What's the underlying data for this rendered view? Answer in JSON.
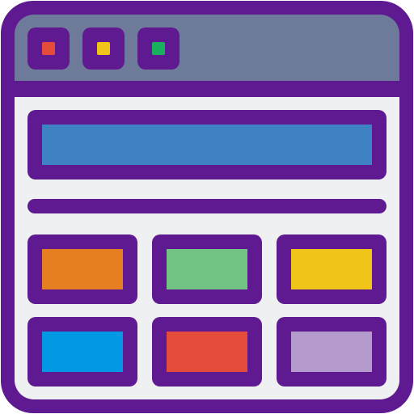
{
  "icon_name": "browser-window-layout-icon",
  "colors": {
    "outline": "#5F1A92",
    "titlebar": "#6E7A99",
    "content_bg": "#EEF0F2",
    "button_close": "#E64C3C",
    "button_minimize": "#F1C419",
    "button_maximize": "#1AAF5D",
    "banner": "#3F82C3",
    "tile_1": "#E67F22",
    "tile_2": "#72C485",
    "tile_3": "#F1C419",
    "tile_4": "#0398E4",
    "tile_5": "#E64C3C",
    "tile_6": "#B49BCC"
  }
}
